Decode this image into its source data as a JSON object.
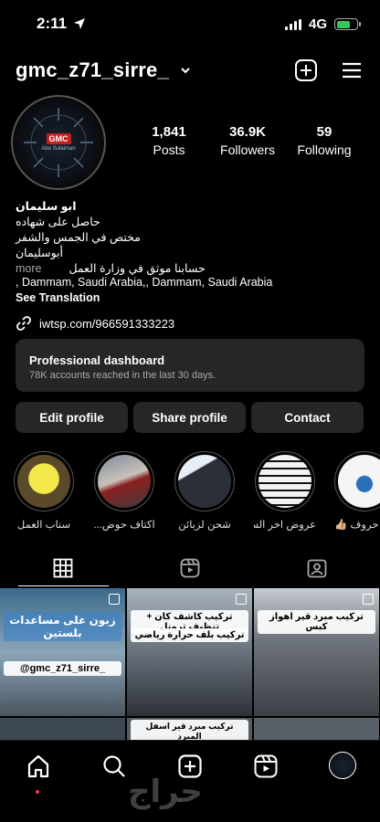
{
  "status": {
    "time": "2:11",
    "network": "4G"
  },
  "profile": {
    "username": "gmc_z71_sirre_",
    "avatar_badge": "GMC",
    "avatar_sub": "Abo Sulaiman",
    "stats": [
      {
        "value": "1,841",
        "label": "Posts"
      },
      {
        "value": "36.9K",
        "label": "Followers"
      },
      {
        "value": "59",
        "label": "Following"
      }
    ],
    "bio_name": "ابو سليمان",
    "bio_lines": [
      "حاصل على شهاده",
      "مختص في الجمس والشفر",
      "أبوسليمان"
    ],
    "bio_last": "حسابنا موثق في وزارة العمل",
    "more": "more",
    "address": ", Dammam, Saudi Arabia,, Dammam, Saudi Arabia",
    "see_translation": "See Translation",
    "link": "iwtsp.com/966591333223"
  },
  "dashboard": {
    "title": "Professional dashboard",
    "subtitle": "78K accounts reached in the last 30 days."
  },
  "buttons": {
    "edit": "Edit profile",
    "share": "Share profile",
    "contact": "Contact"
  },
  "highlights": [
    {
      "label": "سناب العمل"
    },
    {
      "label": "اكتاف حوض..."
    },
    {
      "label": "شحن لزبائن"
    },
    {
      "label": "عروض اخر السـ..."
    },
    {
      "label": "حروف 👍🏼"
    }
  ],
  "grid": {
    "captions": [
      "زبون على مساعدات بلستين",
      "@gmc_z71_sirre_",
      "تركيب كاشف كان + تنظيف ترونل",
      "تركيب بلف حرارة رياضي",
      "تركيب مبرد قير اهواز كبس",
      "تركيب مبرد قير اسفل المبرد"
    ]
  },
  "watermark": "حراج"
}
